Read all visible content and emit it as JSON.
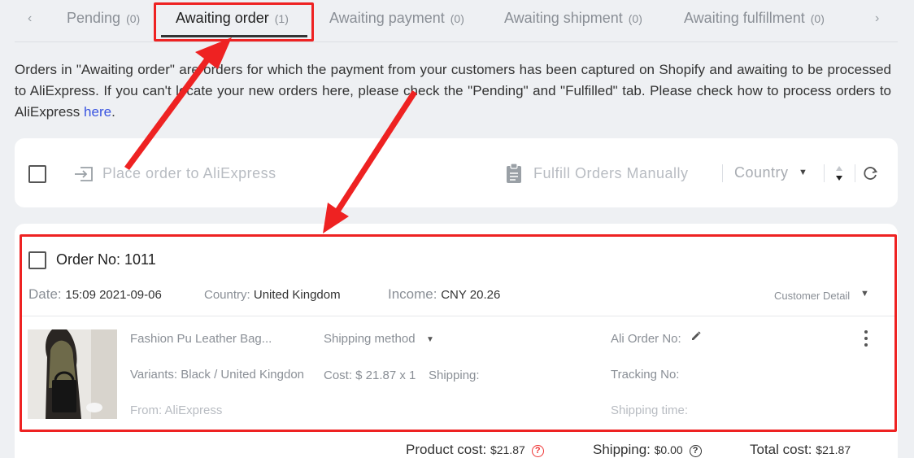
{
  "tabs": [
    {
      "label": "Pending",
      "count": "(0)"
    },
    {
      "label": "Awaiting order",
      "count": "(1)"
    },
    {
      "label": "Awaiting payment",
      "count": "(0)"
    },
    {
      "label": "Awaiting shipment",
      "count": "(0)"
    },
    {
      "label": "Awaiting fulfillment",
      "count": "(0)"
    }
  ],
  "description": {
    "text": "Orders in \"Awaiting order\" are orders for which the payment from your customers has been captured on Shopify and awaiting to be processed to AliExpress. If you can't locate your new orders here, please check the \"Pending\" and \"Fulfilled\" tab. Please check how to process orders to AliExpress ",
    "link": "here",
    "end": "."
  },
  "toolbar": {
    "place_order": "Place order to AliExpress",
    "fulfill_manually": "Fulfill Orders Manually",
    "country": "Country"
  },
  "order": {
    "title": "Order No: 1011",
    "date_label": "Date:",
    "date_value": "15:09 2021-09-06",
    "country_label": "Country:",
    "country_value": "United Kingdom",
    "income_label": "Income:",
    "income_value": "CNY 20.26",
    "customer_detail": "Customer Detail",
    "product": {
      "name": "Fashion Pu Leather Bag...",
      "variants": "Variants: Black / United Kingdon",
      "from": "From: AliExpress",
      "shipping_method": "Shipping method",
      "cost": "Cost: $ 21.87 x 1",
      "shipping": "Shipping:",
      "ali_order_no": "Ali Order No:",
      "tracking_no": "Tracking No:",
      "shipping_time": "Shipping time:"
    }
  },
  "summary": {
    "product_cost_label": "Product cost:",
    "product_cost_value": "$21.87",
    "shipping_label": "Shipping:",
    "shipping_value": "$0.00",
    "total_label": "Total cost:",
    "total_value": "$21.87"
  },
  "colors": {
    "highlight": "#ee2222",
    "link": "#3a55e0"
  }
}
